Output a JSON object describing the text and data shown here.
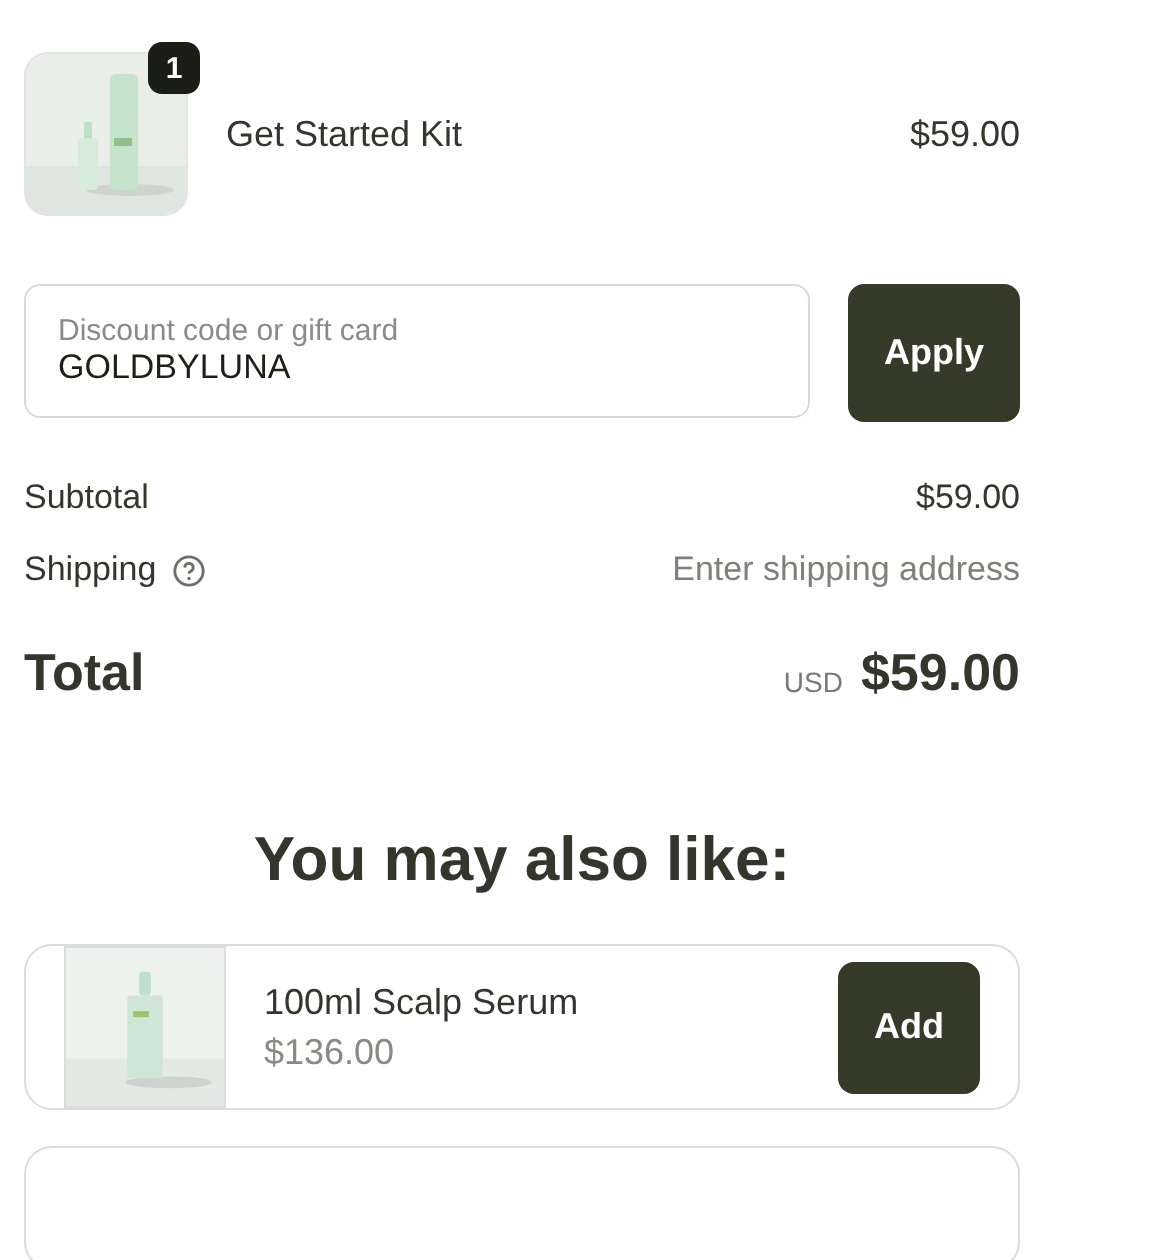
{
  "cart_item": {
    "quantity": "1",
    "name": "Get Started Kit",
    "price": "$59.00"
  },
  "discount": {
    "placeholder": "Discount code or gift card",
    "value": "GOLDBYLUNA",
    "button": "Apply"
  },
  "summary": [
    {
      "label": "Subtotal",
      "value": "$59.00",
      "help": false,
      "muted": false
    },
    {
      "label": "Shipping",
      "value": "Enter shipping address",
      "help": true,
      "muted": true
    }
  ],
  "total": {
    "label": "Total",
    "currency": "USD",
    "amount": "$59.00"
  },
  "recommendations": {
    "heading": "You may also like:",
    "items": [
      {
        "name": "100ml Scalp Serum",
        "price": "$136.00",
        "button": "Add"
      }
    ]
  }
}
